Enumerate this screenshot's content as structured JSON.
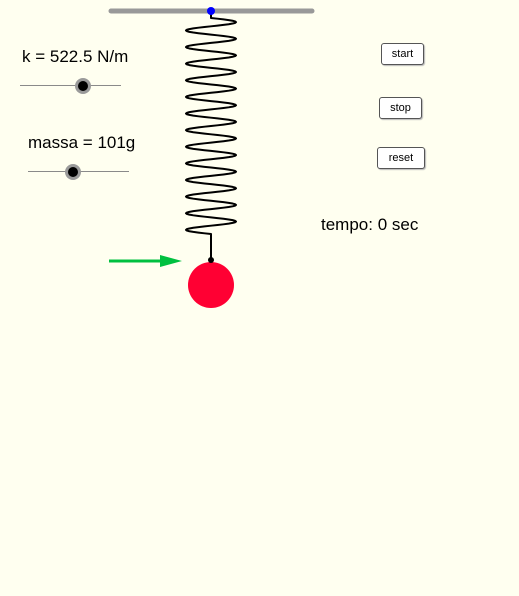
{
  "spring_constant": {
    "label": "k = 522.5 N/m",
    "value": 522.5,
    "unit": "N/m",
    "slider_fraction": 0.62
  },
  "mass": {
    "label": "massa = 101g",
    "value": 101,
    "unit": "g",
    "slider_fraction": 0.45
  },
  "controls": {
    "start_label": "start",
    "stop_label": "stop",
    "reset_label": "reset"
  },
  "time_readout": "tempo: 0 sec",
  "colors": {
    "background": "#fffff0",
    "ceiling": "#999999",
    "anchor": "#0000ff",
    "spring": "#000000",
    "mass": "#ff0033",
    "arrow": "#00c040"
  }
}
